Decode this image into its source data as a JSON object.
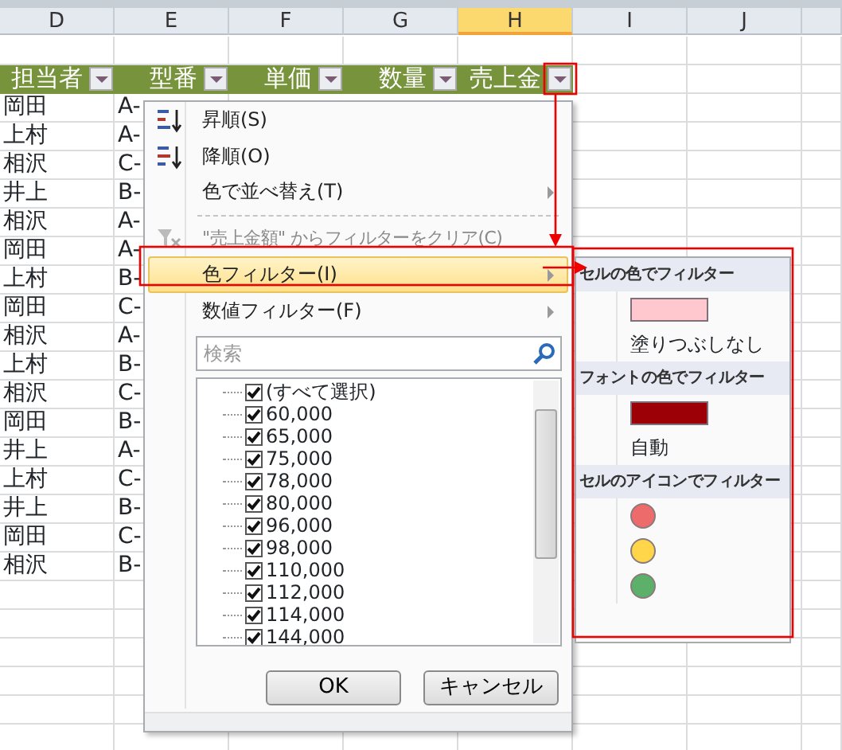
{
  "columns": [
    {
      "letter": "D",
      "selected": false
    },
    {
      "letter": "E",
      "selected": false
    },
    {
      "letter": "F",
      "selected": false
    },
    {
      "letter": "G",
      "selected": false
    },
    {
      "letter": "H",
      "selected": true
    },
    {
      "letter": "I",
      "selected": false
    },
    {
      "letter": "J",
      "selected": false
    }
  ],
  "header_row": [
    "担当者",
    "型番",
    "単価",
    "数量",
    "売上金"
  ],
  "rows": [
    {
      "person": "岡田",
      "model": "A-"
    },
    {
      "person": "上村",
      "model": "A-"
    },
    {
      "person": "相沢",
      "model": "C-"
    },
    {
      "person": "井上",
      "model": "B-"
    },
    {
      "person": "相沢",
      "model": "A-"
    },
    {
      "person": "岡田",
      "model": "A-"
    },
    {
      "person": "上村",
      "model": "B-"
    },
    {
      "person": "岡田",
      "model": "C-"
    },
    {
      "person": "相沢",
      "model": "A-"
    },
    {
      "person": "上村",
      "model": "B-"
    },
    {
      "person": "相沢",
      "model": "C-"
    },
    {
      "person": "岡田",
      "model": "B-"
    },
    {
      "person": "井上",
      "model": "A-"
    },
    {
      "person": "上村",
      "model": "C-"
    },
    {
      "person": "井上",
      "model": "B-"
    },
    {
      "person": "岡田",
      "model": "C-"
    },
    {
      "person": "相沢",
      "model": "B-"
    }
  ],
  "filter_menu": {
    "items": [
      {
        "kind": "sort-asc",
        "label": "昇順(S)",
        "disabled": false,
        "highlighted": false,
        "submenu": false
      },
      {
        "kind": "sort-desc",
        "label": "降順(O)",
        "disabled": false,
        "highlighted": false,
        "submenu": false
      },
      {
        "kind": "plain",
        "label": "色で並べ替え(T)",
        "disabled": false,
        "highlighted": false,
        "submenu": true
      },
      {
        "kind": "separator"
      },
      {
        "kind": "clear",
        "label": "\"売上金額\" からフィルターをクリア(C)",
        "disabled": true,
        "highlighted": false,
        "submenu": false
      },
      {
        "kind": "plain",
        "label": "色フィルター(I)",
        "disabled": false,
        "highlighted": true,
        "submenu": true
      },
      {
        "kind": "plain",
        "label": "数値フィルター(F)",
        "disabled": false,
        "highlighted": false,
        "submenu": true
      }
    ],
    "search": {
      "placeholder": "検索"
    },
    "values": [
      {
        "label": "(すべて選択)",
        "checked": true
      },
      {
        "label": "60,000",
        "checked": true
      },
      {
        "label": "65,000",
        "checked": true
      },
      {
        "label": "75,000",
        "checked": true
      },
      {
        "label": "78,000",
        "checked": true
      },
      {
        "label": "80,000",
        "checked": true
      },
      {
        "label": "96,000",
        "checked": true
      },
      {
        "label": "98,000",
        "checked": true
      },
      {
        "label": "110,000",
        "checked": true
      },
      {
        "label": "112,000",
        "checked": true
      },
      {
        "label": "114,000",
        "checked": true
      },
      {
        "label": "144,000",
        "checked": true
      }
    ],
    "buttons": [
      "OK",
      "キャンセル"
    ]
  },
  "color_submenu": {
    "sections": [
      {
        "title": "セルの色でフィルター",
        "items": [
          {
            "kind": "swatch",
            "color": "#ffc7ce"
          },
          {
            "kind": "text",
            "label": "塗りつぶしなし"
          }
        ]
      },
      {
        "title": "フォントの色でフィルター",
        "items": [
          {
            "kind": "swatch",
            "color": "#9c0006"
          },
          {
            "kind": "text",
            "label": "自動"
          }
        ]
      },
      {
        "title": "セルのアイコンでフィルター",
        "items": [
          {
            "kind": "dot",
            "color": "#ee6b6b"
          },
          {
            "kind": "dot",
            "color": "#ffd54a"
          },
          {
            "kind": "dot",
            "color": "#5cb06a"
          }
        ]
      }
    ]
  }
}
